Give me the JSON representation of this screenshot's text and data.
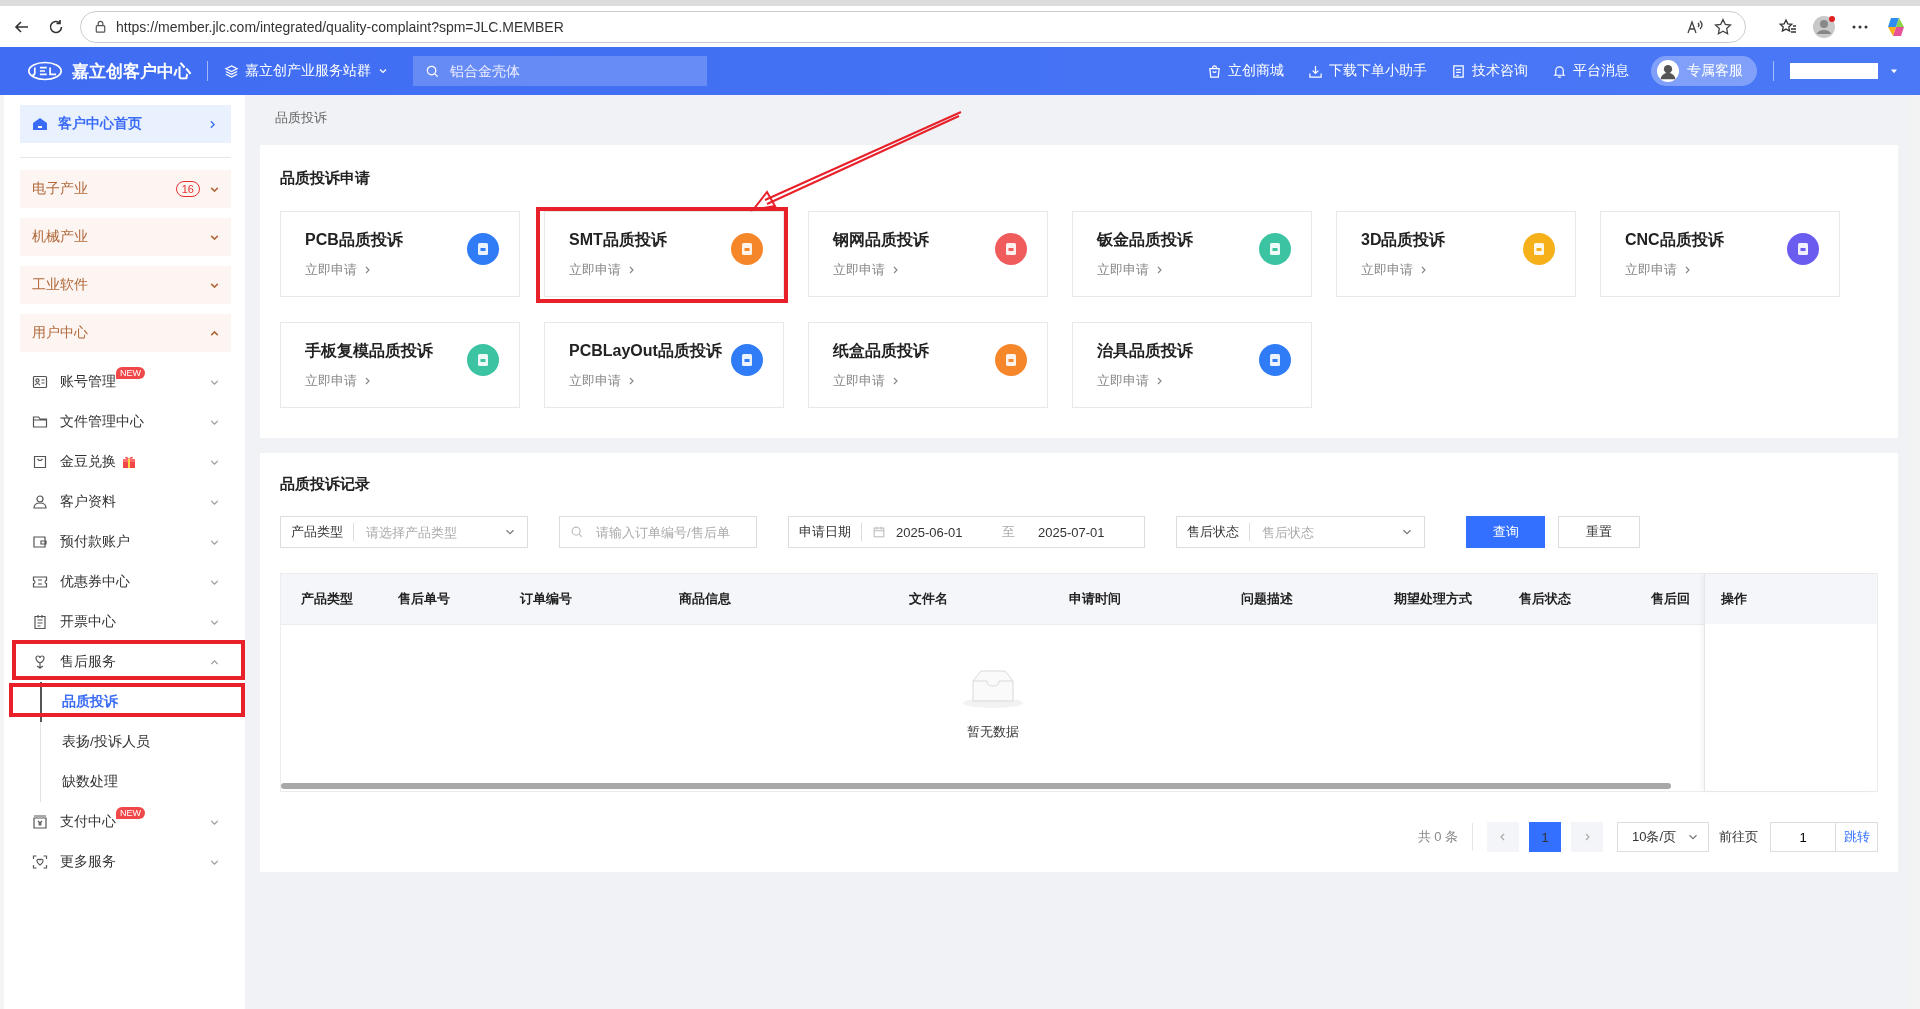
{
  "browser": {
    "url": "https://member.jlc.com/integrated/quality-complaint?spm=JLC.MEMBER"
  },
  "header": {
    "logo_text": "嘉立创客户中心",
    "site_group": "嘉立创产业服务站群",
    "search": {
      "placeholder": "铝合金壳体"
    },
    "nav": [
      "立创商城",
      "下载下单小助手",
      "技术咨询",
      "平台消息"
    ],
    "service_button": "专属客服"
  },
  "sidebar": {
    "home": "客户中心首页",
    "groups": [
      {
        "label": "电子产业",
        "badge": "16",
        "expanded": false
      },
      {
        "label": "机械产业",
        "expanded": false
      },
      {
        "label": "工业软件",
        "expanded": false
      },
      {
        "label": "用户中心",
        "expanded": true,
        "items": [
          {
            "label": "账号管理",
            "tag": "NEW",
            "expanded": false,
            "annotated": false
          },
          {
            "label": "文件管理中心",
            "expanded": false,
            "annotated": false
          },
          {
            "label": "金豆兑换",
            "expanded": false,
            "annotated": false
          },
          {
            "label": "客户资料",
            "expanded": false,
            "annotated": false
          },
          {
            "label": "预付款账户",
            "expanded": false,
            "annotated": false
          },
          {
            "label": "优惠券中心",
            "expanded": false,
            "annotated": false
          },
          {
            "label": "开票中心",
            "expanded": false,
            "annotated": false
          },
          {
            "label": "售后服务",
            "expanded": true,
            "annotated": true,
            "children": [
              {
                "label": "品质投诉",
                "selected": true,
                "annotated": true
              },
              {
                "label": "表扬/投诉人员",
                "selected": false,
                "annotated": false
              },
              {
                "label": "缺数处理",
                "selected": false,
                "annotated": false
              }
            ]
          },
          {
            "label": "支付中心",
            "tag": "NEW",
            "expanded": false,
            "annotated": false
          },
          {
            "label": "更多服务",
            "expanded": false,
            "annotated": false
          }
        ]
      }
    ]
  },
  "breadcrumb": "品质投诉",
  "apply": {
    "title": "品质投诉申请",
    "cards": [
      {
        "title": "PCB品质投诉",
        "action": "立即申请",
        "color": "#2f7cf6",
        "annotated": false
      },
      {
        "title": "SMT品质投诉",
        "action": "立即申请",
        "color": "#f5862a",
        "annotated": true
      },
      {
        "title": "钢网品质投诉",
        "action": "立即申请",
        "color": "#f05c5c",
        "annotated": false
      },
      {
        "title": "钣金品质投诉",
        "action": "立即申请",
        "color": "#3cc4a2",
        "annotated": false
      },
      {
        "title": "3D品质投诉",
        "action": "立即申请",
        "color": "#f5b01a",
        "annotated": false
      },
      {
        "title": "CNC品质投诉",
        "action": "立即申请",
        "color": "#6b5cf0",
        "annotated": false
      },
      {
        "title": "手板复模品质投诉",
        "action": "立即申请",
        "color": "#3cc4a2",
        "annotated": false
      },
      {
        "title": "PCBLayOut品质投诉",
        "action": "立即申请",
        "color": "#2f7cf6",
        "annotated": false
      },
      {
        "title": "纸盒品质投诉",
        "action": "立即申请",
        "color": "#f5862a",
        "annotated": false
      },
      {
        "title": "治具品质投诉",
        "action": "立即申请",
        "color": "#2f7cf6",
        "annotated": false
      }
    ]
  },
  "records": {
    "title": "品质投诉记录",
    "filters": {
      "product_type": {
        "label": "产品类型",
        "placeholder": "请选择产品类型"
      },
      "search": {
        "placeholder": "请输入订单编号/售后单"
      },
      "date": {
        "label": "申请日期",
        "start": "2025-06-01",
        "separator": "至",
        "end": "2025-07-01"
      },
      "status": {
        "label": "售后状态",
        "placeholder": "售后状态"
      }
    },
    "buttons": [
      "查询",
      "重置"
    ],
    "table": {
      "columns": [
        "产品类型",
        "售后单号",
        "订单编号",
        "商品信息",
        "文件名",
        "申请时间",
        "问题描述",
        "期望处理方式",
        "售后状态",
        "售后回"
      ],
      "fixed_column": "操作",
      "empty_text": "暂无数据"
    },
    "pagination": {
      "total": "共 0 条",
      "pages": [
        {
          "label": "1",
          "selected": true
        }
      ],
      "page_size": "10条/页",
      "goto_label": "前往页",
      "goto_value": "1",
      "jump": "跳转"
    }
  }
}
